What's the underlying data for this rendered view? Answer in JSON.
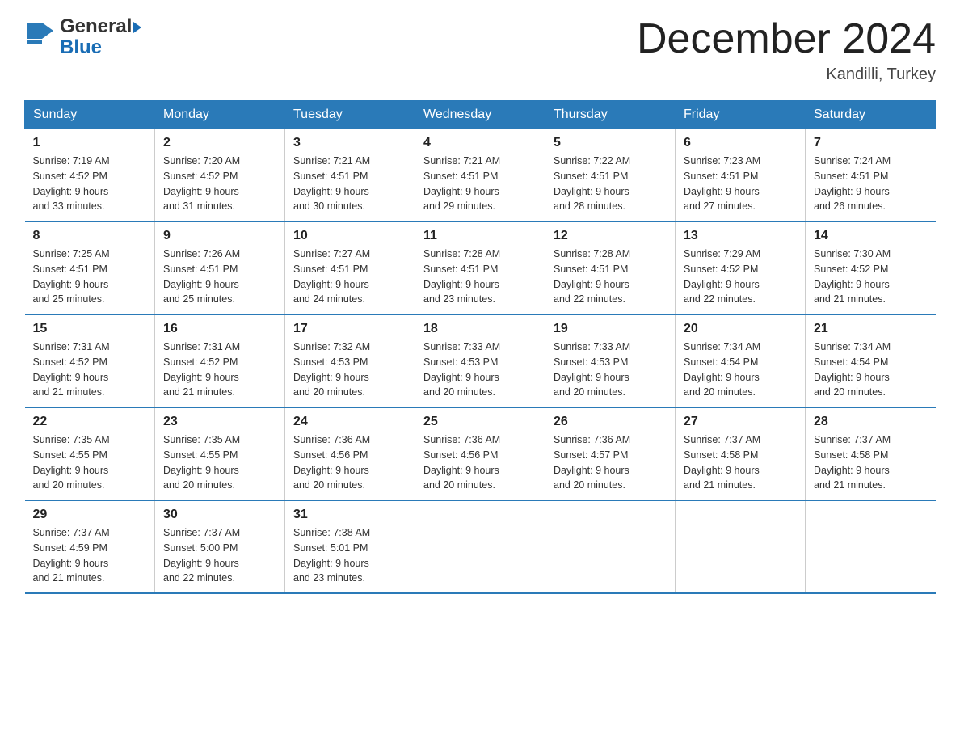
{
  "header": {
    "logo_general": "General",
    "logo_blue": "Blue",
    "month_title": "December 2024",
    "location": "Kandilli, Turkey"
  },
  "weekdays": [
    "Sunday",
    "Monday",
    "Tuesday",
    "Wednesday",
    "Thursday",
    "Friday",
    "Saturday"
  ],
  "weeks": [
    [
      {
        "day": "1",
        "sunrise": "7:19 AM",
        "sunset": "4:52 PM",
        "daylight": "9 hours and 33 minutes."
      },
      {
        "day": "2",
        "sunrise": "7:20 AM",
        "sunset": "4:52 PM",
        "daylight": "9 hours and 31 minutes."
      },
      {
        "day": "3",
        "sunrise": "7:21 AM",
        "sunset": "4:51 PM",
        "daylight": "9 hours and 30 minutes."
      },
      {
        "day": "4",
        "sunrise": "7:21 AM",
        "sunset": "4:51 PM",
        "daylight": "9 hours and 29 minutes."
      },
      {
        "day": "5",
        "sunrise": "7:22 AM",
        "sunset": "4:51 PM",
        "daylight": "9 hours and 28 minutes."
      },
      {
        "day": "6",
        "sunrise": "7:23 AM",
        "sunset": "4:51 PM",
        "daylight": "9 hours and 27 minutes."
      },
      {
        "day": "7",
        "sunrise": "7:24 AM",
        "sunset": "4:51 PM",
        "daylight": "9 hours and 26 minutes."
      }
    ],
    [
      {
        "day": "8",
        "sunrise": "7:25 AM",
        "sunset": "4:51 PM",
        "daylight": "9 hours and 25 minutes."
      },
      {
        "day": "9",
        "sunrise": "7:26 AM",
        "sunset": "4:51 PM",
        "daylight": "9 hours and 25 minutes."
      },
      {
        "day": "10",
        "sunrise": "7:27 AM",
        "sunset": "4:51 PM",
        "daylight": "9 hours and 24 minutes."
      },
      {
        "day": "11",
        "sunrise": "7:28 AM",
        "sunset": "4:51 PM",
        "daylight": "9 hours and 23 minutes."
      },
      {
        "day": "12",
        "sunrise": "7:28 AM",
        "sunset": "4:51 PM",
        "daylight": "9 hours and 22 minutes."
      },
      {
        "day": "13",
        "sunrise": "7:29 AM",
        "sunset": "4:52 PM",
        "daylight": "9 hours and 22 minutes."
      },
      {
        "day": "14",
        "sunrise": "7:30 AM",
        "sunset": "4:52 PM",
        "daylight": "9 hours and 21 minutes."
      }
    ],
    [
      {
        "day": "15",
        "sunrise": "7:31 AM",
        "sunset": "4:52 PM",
        "daylight": "9 hours and 21 minutes."
      },
      {
        "day": "16",
        "sunrise": "7:31 AM",
        "sunset": "4:52 PM",
        "daylight": "9 hours and 21 minutes."
      },
      {
        "day": "17",
        "sunrise": "7:32 AM",
        "sunset": "4:53 PM",
        "daylight": "9 hours and 20 minutes."
      },
      {
        "day": "18",
        "sunrise": "7:33 AM",
        "sunset": "4:53 PM",
        "daylight": "9 hours and 20 minutes."
      },
      {
        "day": "19",
        "sunrise": "7:33 AM",
        "sunset": "4:53 PM",
        "daylight": "9 hours and 20 minutes."
      },
      {
        "day": "20",
        "sunrise": "7:34 AM",
        "sunset": "4:54 PM",
        "daylight": "9 hours and 20 minutes."
      },
      {
        "day": "21",
        "sunrise": "7:34 AM",
        "sunset": "4:54 PM",
        "daylight": "9 hours and 20 minutes."
      }
    ],
    [
      {
        "day": "22",
        "sunrise": "7:35 AM",
        "sunset": "4:55 PM",
        "daylight": "9 hours and 20 minutes."
      },
      {
        "day": "23",
        "sunrise": "7:35 AM",
        "sunset": "4:55 PM",
        "daylight": "9 hours and 20 minutes."
      },
      {
        "day": "24",
        "sunrise": "7:36 AM",
        "sunset": "4:56 PM",
        "daylight": "9 hours and 20 minutes."
      },
      {
        "day": "25",
        "sunrise": "7:36 AM",
        "sunset": "4:56 PM",
        "daylight": "9 hours and 20 minutes."
      },
      {
        "day": "26",
        "sunrise": "7:36 AM",
        "sunset": "4:57 PM",
        "daylight": "9 hours and 20 minutes."
      },
      {
        "day": "27",
        "sunrise": "7:37 AM",
        "sunset": "4:58 PM",
        "daylight": "9 hours and 21 minutes."
      },
      {
        "day": "28",
        "sunrise": "7:37 AM",
        "sunset": "4:58 PM",
        "daylight": "9 hours and 21 minutes."
      }
    ],
    [
      {
        "day": "29",
        "sunrise": "7:37 AM",
        "sunset": "4:59 PM",
        "daylight": "9 hours and 21 minutes."
      },
      {
        "day": "30",
        "sunrise": "7:37 AM",
        "sunset": "5:00 PM",
        "daylight": "9 hours and 22 minutes."
      },
      {
        "day": "31",
        "sunrise": "7:38 AM",
        "sunset": "5:01 PM",
        "daylight": "9 hours and 23 minutes."
      },
      null,
      null,
      null,
      null
    ]
  ],
  "labels": {
    "sunrise": "Sunrise:",
    "sunset": "Sunset:",
    "daylight": "Daylight:"
  }
}
